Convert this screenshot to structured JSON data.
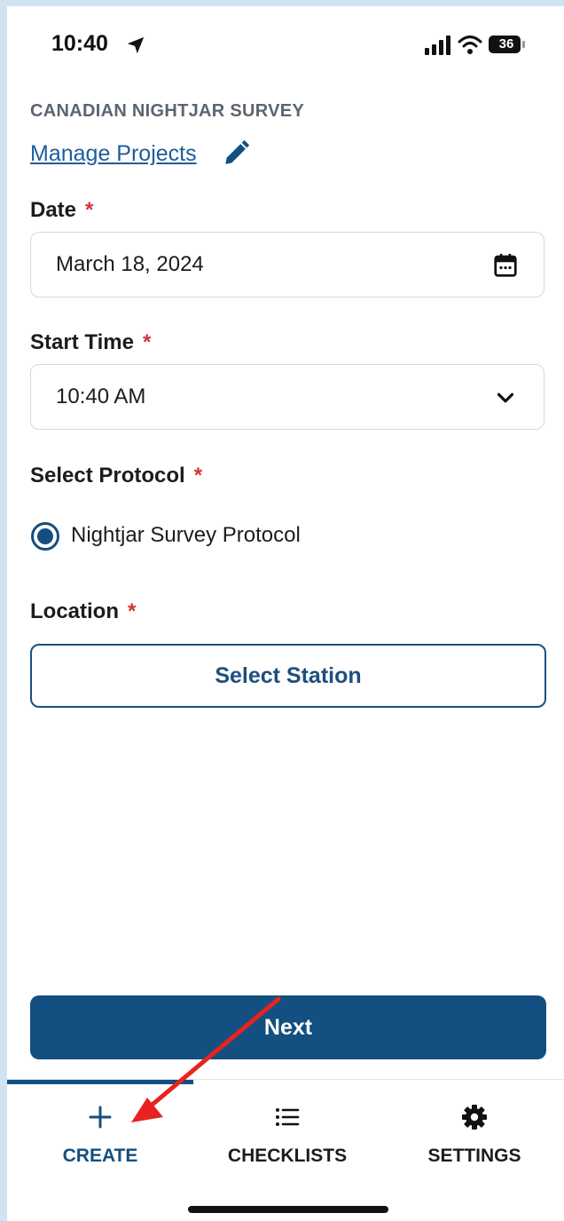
{
  "status_bar": {
    "time": "10:40",
    "battery_level": "36",
    "icons": [
      "location-arrow-icon",
      "signal-icon",
      "wifi-icon",
      "battery-icon"
    ]
  },
  "header": {
    "project_name": "CANADIAN NIGHTJAR SURVEY",
    "manage_link": "Manage Projects",
    "edit_icon": "pencil-icon"
  },
  "form": {
    "required_marker": "*",
    "date": {
      "label": "Date",
      "value": "March 18, 2024",
      "icon": "calendar-icon"
    },
    "start_time": {
      "label": "Start Time",
      "value": "10:40 AM",
      "icon": "chevron-down-icon"
    },
    "protocol": {
      "label": "Select Protocol",
      "option": "Nightjar Survey Protocol",
      "selected": true
    },
    "location": {
      "label": "Location",
      "button": "Select Station"
    },
    "next_button": "Next"
  },
  "tabs": [
    {
      "label": "CREATE",
      "icon": "plus-icon",
      "active": true
    },
    {
      "label": "CHECKLISTS",
      "icon": "list-icon",
      "active": false
    },
    {
      "label": "SETTINGS",
      "icon": "gear-icon",
      "active": false
    }
  ],
  "colors": {
    "primary": "#134f80",
    "link": "#1e5d9a",
    "required": "#d03434",
    "annotation_arrow": "#e8231f"
  }
}
